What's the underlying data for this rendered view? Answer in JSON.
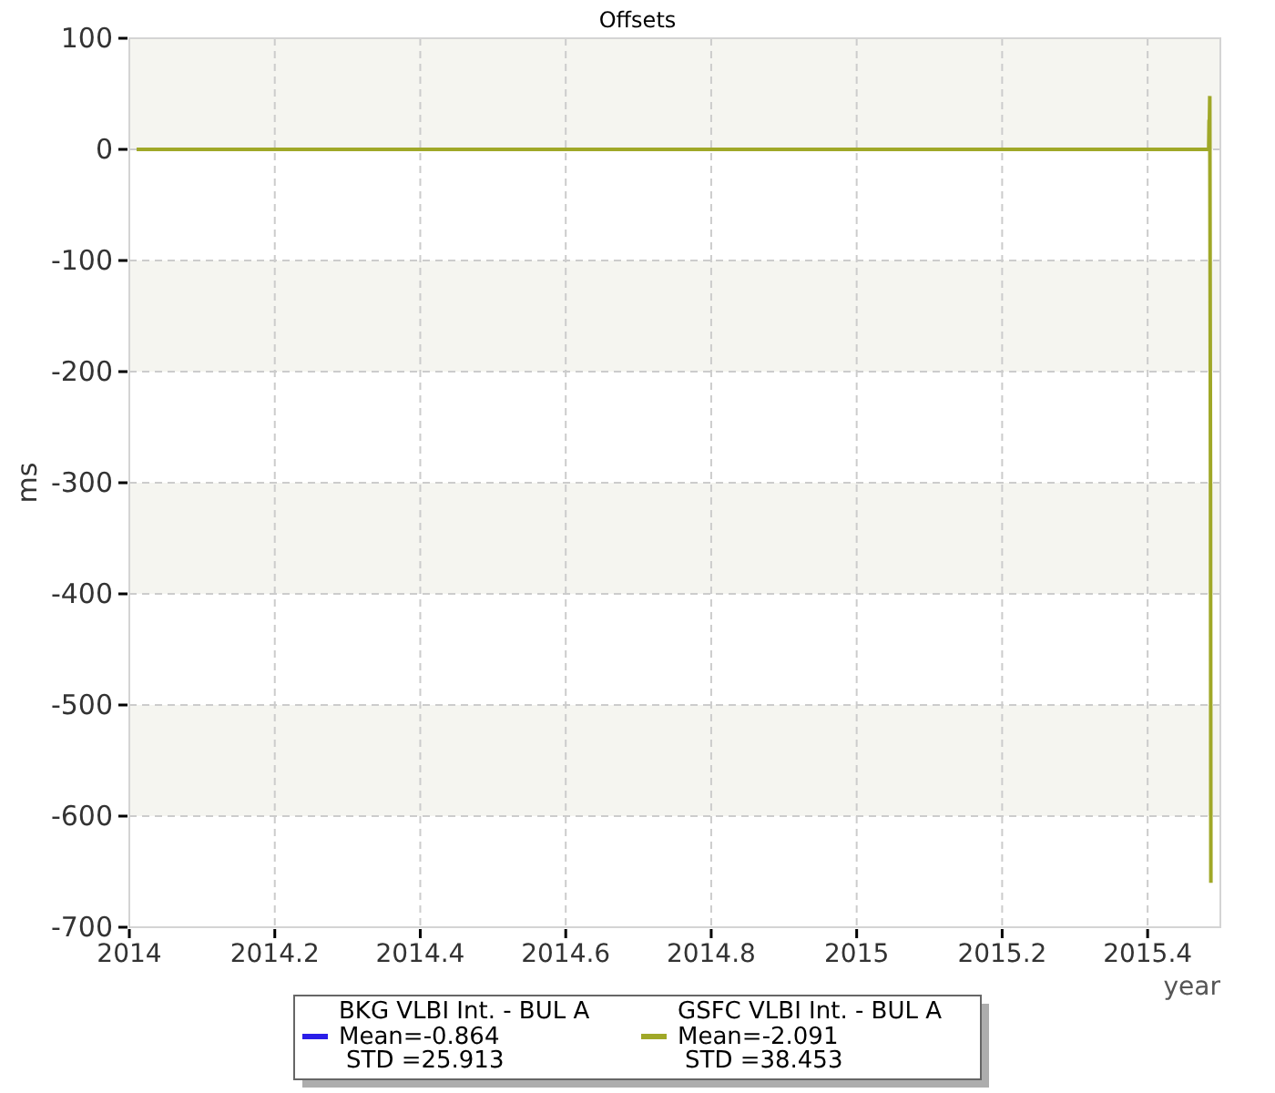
{
  "chart_data": {
    "type": "line",
    "title": "Offsets",
    "xlabel": "year",
    "ylabel": "ms",
    "x": [
      2014.01,
      2015.484,
      2015.4845,
      2015.485,
      2015.4855,
      2015.4865,
      2015.487
    ],
    "series": [
      {
        "name": "GSFC VLBI Int. - BUL A",
        "color": "#a0a828",
        "values": [
          0,
          0,
          25,
          25,
          48,
          -305,
          -660
        ]
      }
    ],
    "grid": true,
    "xlim": [
      2014,
      2015.5
    ],
    "ylim": [
      -700,
      100
    ],
    "xticks": [
      {
        "value": 2014,
        "label": "2014"
      },
      {
        "value": 2014.2,
        "label": "2014.2"
      },
      {
        "value": 2014.4,
        "label": "2014.4"
      },
      {
        "value": 2014.6,
        "label": "2014.6"
      },
      {
        "value": 2014.8,
        "label": "2014.8"
      },
      {
        "value": 2015,
        "label": "2015"
      },
      {
        "value": 2015.2,
        "label": "2015.2"
      },
      {
        "value": 2015.4,
        "label": "2015.4"
      }
    ],
    "yticks": [
      {
        "value": 100,
        "label": "100"
      },
      {
        "value": 0,
        "label": "0"
      },
      {
        "value": -100,
        "label": "-100"
      },
      {
        "value": -200,
        "label": "-200"
      },
      {
        "value": -300,
        "label": "-300"
      },
      {
        "value": -400,
        "label": "-400"
      },
      {
        "value": -500,
        "label": "-500"
      },
      {
        "value": -600,
        "label": "-600"
      },
      {
        "value": -700,
        "label": "-700"
      }
    ]
  },
  "legend": [
    {
      "kind": "own",
      "name": "BKG VLBI Int. - BUL A",
      "color": "#2a1ee8",
      "mean": "Mean=-0.864",
      "std": "STD =25.913"
    },
    {
      "kind": "series",
      "mean": "Mean=-2.091",
      "std": "STD =38.453"
    }
  ]
}
